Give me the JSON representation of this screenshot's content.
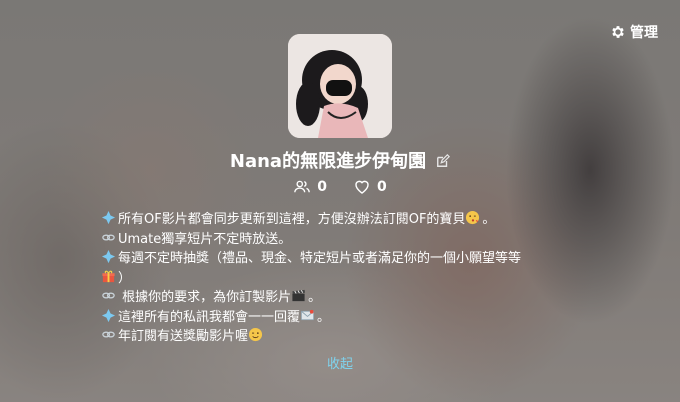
{
  "header": {
    "manage_label": "管理",
    "manage_icon": "gear-icon"
  },
  "profile": {
    "name": "Nana的無限進步伊甸園",
    "edit_icon": "edit-icon",
    "followers_count": "0",
    "likes_count": "0"
  },
  "bio": {
    "lines": [
      "所有OF影片都會同步更新到這裡，方便沒辦法訂閱OF的寶貝",
      "。",
      "Umate獨享短片不定時放送。",
      "每週不定時抽獎（禮品、現金、特定短片或者滿足你的一個小願望等等",
      "）",
      " 根據你的要求，為你訂製影片",
      "。",
      "這裡所有的私訊我都會一一回覆",
      "。",
      "年訂閱有送獎勵影片喔"
    ],
    "collapse_label": "收起"
  },
  "colors": {
    "accent": "#7fd3ee",
    "text": "#ffffff"
  }
}
